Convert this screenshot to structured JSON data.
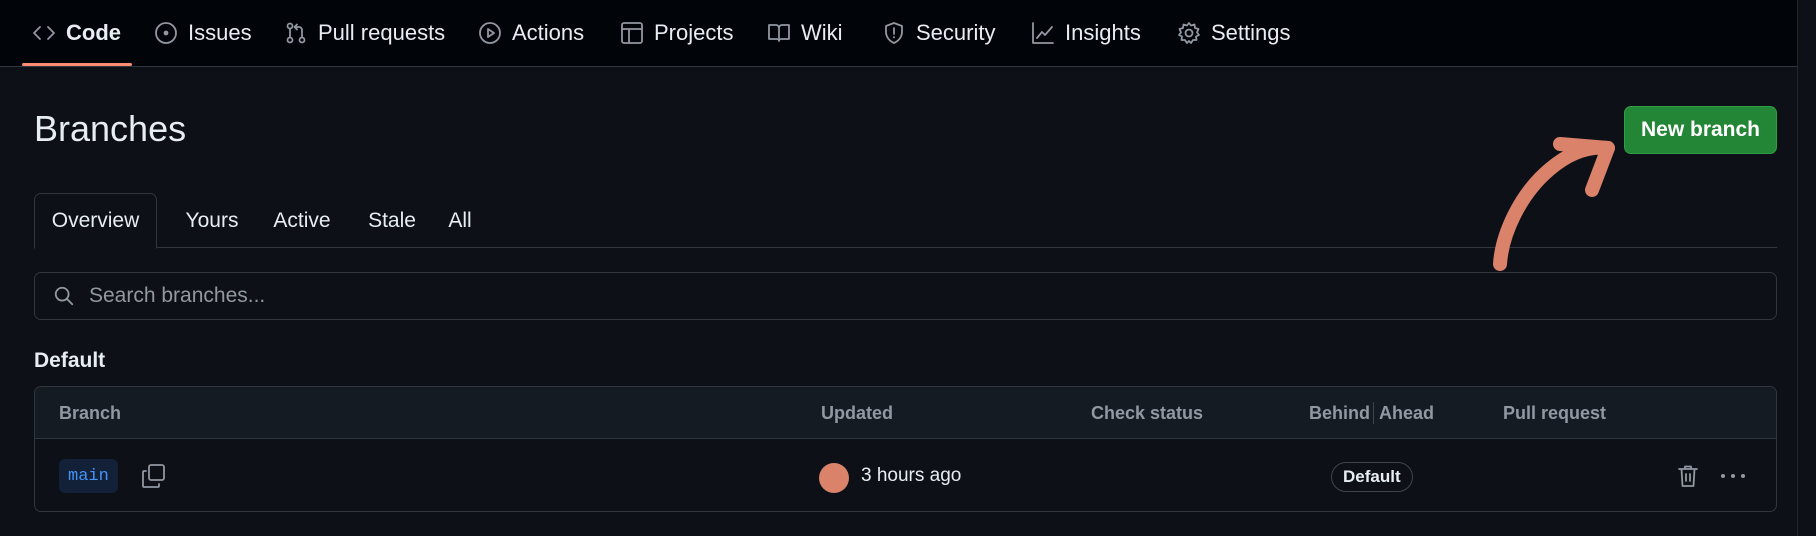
{
  "nav": {
    "items": [
      {
        "label": "Code",
        "icon": "code-icon",
        "active": true
      },
      {
        "label": "Issues",
        "icon": "issue-opened-icon"
      },
      {
        "label": "Pull requests",
        "icon": "git-pull-request-icon"
      },
      {
        "label": "Actions",
        "icon": "play-icon"
      },
      {
        "label": "Projects",
        "icon": "table-icon"
      },
      {
        "label": "Wiki",
        "icon": "book-icon"
      },
      {
        "label": "Security",
        "icon": "shield-icon"
      },
      {
        "label": "Insights",
        "icon": "graph-icon"
      },
      {
        "label": "Settings",
        "icon": "gear-icon"
      }
    ]
  },
  "page": {
    "title": "Branches",
    "new_branch_label": "New branch"
  },
  "tabs": [
    {
      "label": "Overview",
      "selected": true
    },
    {
      "label": "Yours"
    },
    {
      "label": "Active"
    },
    {
      "label": "Stale"
    },
    {
      "label": "All"
    }
  ],
  "search": {
    "placeholder": "Search branches..."
  },
  "section": {
    "heading": "Default"
  },
  "table": {
    "columns": {
      "branch": "Branch",
      "updated": "Updated",
      "check_status": "Check status",
      "behind": "Behind",
      "ahead": "Ahead",
      "pull_request": "Pull request"
    },
    "rows": [
      {
        "branch": "main",
        "updated": "3 hours ago",
        "badge": "Default"
      }
    ]
  },
  "colors": {
    "background": "#0d1117",
    "nav_background": "#010409",
    "accent_underline": "#fd8c73",
    "primary_button": "#238636",
    "link_blue": "#4493f8",
    "annotation_arrow": "#da826a"
  }
}
